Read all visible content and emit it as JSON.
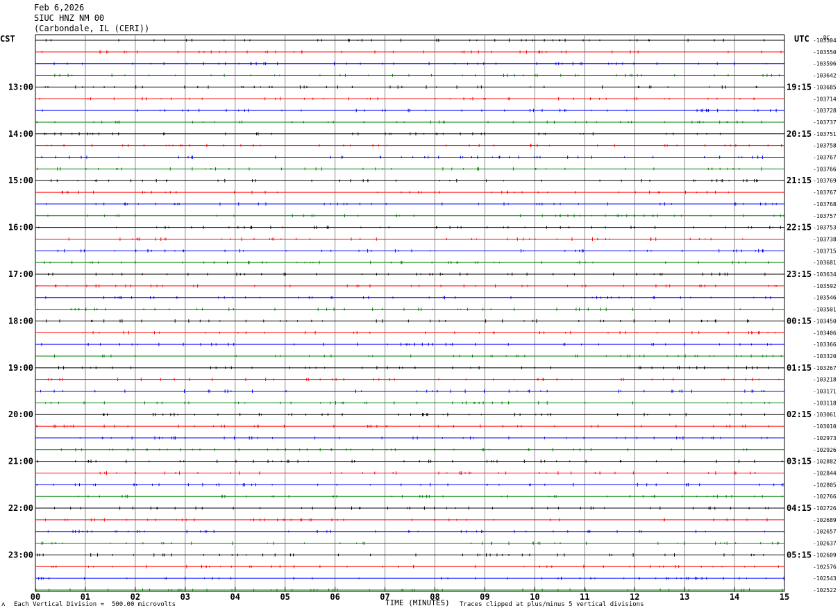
{
  "header": {
    "date": "Feb 6,2026",
    "station": "SIUC HNZ NM 00",
    "location": "(Carbondale, IL (CERI))"
  },
  "footer": {
    "left_note": "Each Vertical Division =  500.00 microvolts",
    "right_note": "Traces clipped at plus/minus 5 vertical divisions",
    "corner_mark": "ᴧ"
  },
  "chart_data": {
    "type": "line",
    "title": "",
    "xlabel": "TIME (MINUTES)",
    "left_axis_label": "CST",
    "right_axis_label": "UTC",
    "right_corner_label": "DC",
    "x_range": [
      0,
      15
    ],
    "x_ticks": [
      "00",
      "01",
      "02",
      "03",
      "04",
      "05",
      "06",
      "07",
      "08",
      "09",
      "10",
      "11",
      "12",
      "13",
      "14",
      "15"
    ],
    "grid": true,
    "trace_colors": [
      "#000000",
      "#ff0000",
      "#0000ff",
      "#008000"
    ],
    "left_hour_labels": [
      "13:00",
      "14:00",
      "15:00",
      "16:00",
      "17:00",
      "18:00",
      "19:00",
      "20:00",
      "21:00",
      "22:00",
      "23:00"
    ],
    "right_hour_labels": [
      "19:15",
      "20:15",
      "21:15",
      "22:15",
      "23:15",
      "00:15",
      "01:15",
      "02:15",
      "03:15",
      "04:15",
      "05:15"
    ],
    "dc_offsets": [
      -103504,
      -103550,
      -103596,
      -103642,
      -103685,
      -103714,
      -103728,
      -103737,
      -103751,
      -103758,
      -103767,
      -103766,
      -103769,
      -103767,
      -103768,
      -103757,
      -103753,
      -103738,
      -103715,
      -103681,
      -103634,
      -103592,
      -103546,
      -103501,
      -103450,
      -103406,
      -103366,
      -103320,
      -103267,
      -103218,
      -103171,
      -103118,
      -103061,
      -103010,
      -102973,
      -102926,
      -102882,
      -102844,
      -102805,
      -102766,
      -102726,
      -102689,
      -102657,
      -102637,
      -102609,
      -102576,
      -102543,
      -102522
    ]
  }
}
